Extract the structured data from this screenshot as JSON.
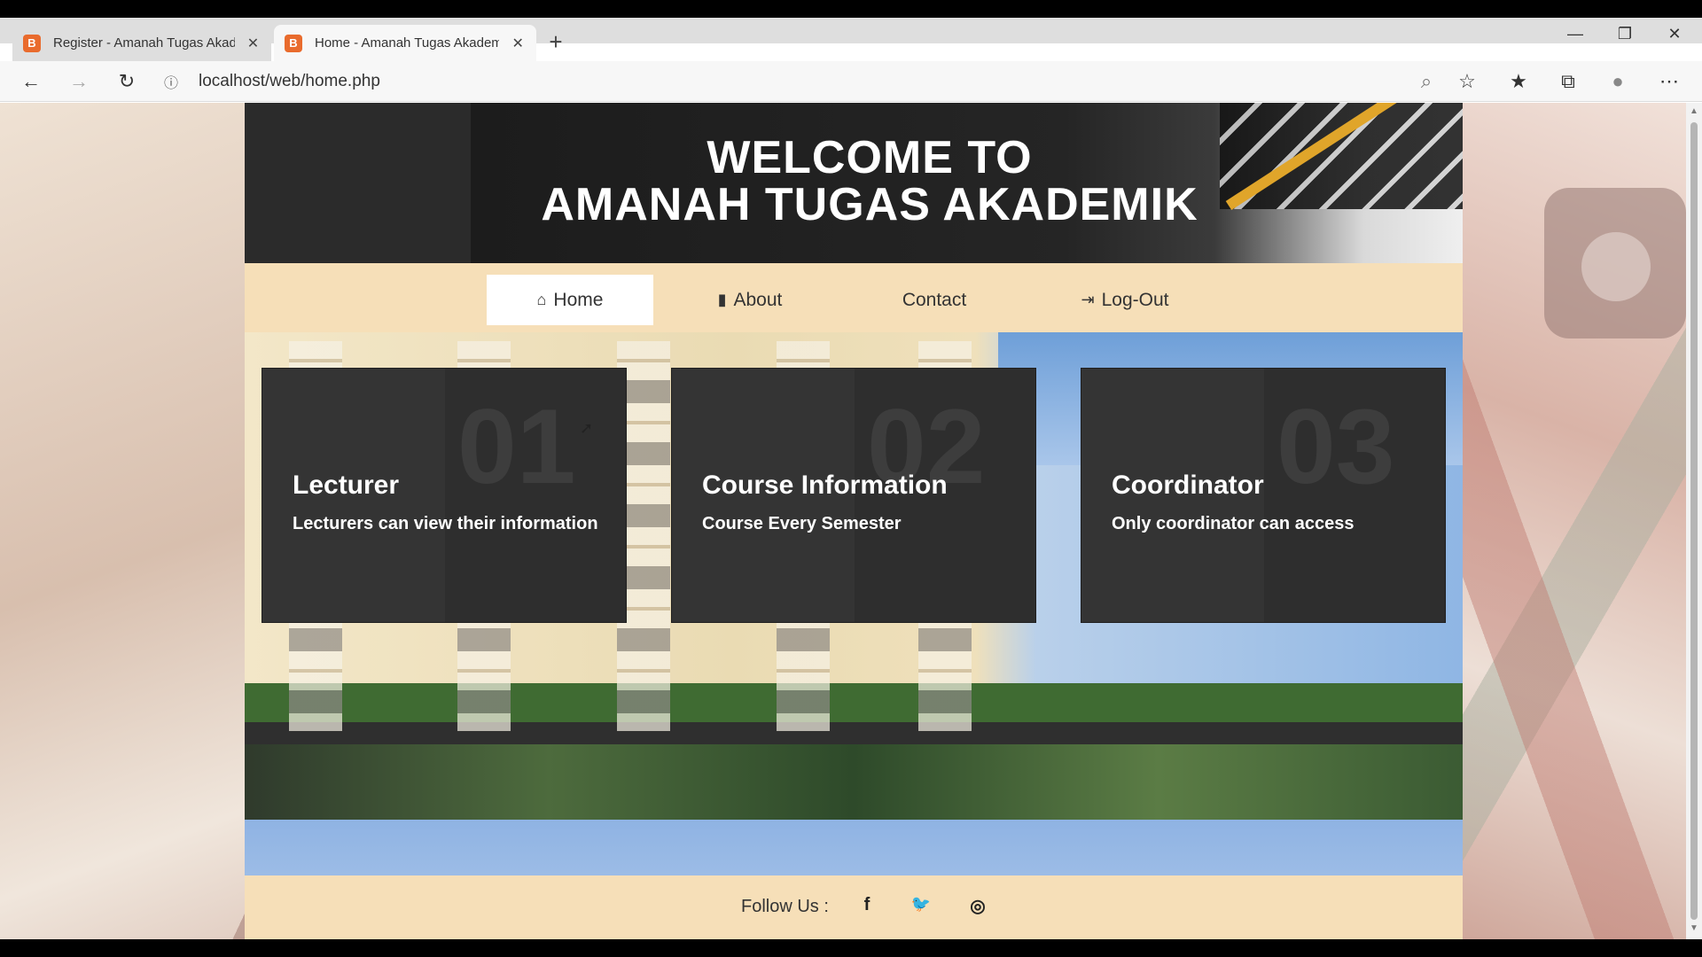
{
  "browser": {
    "tabs": [
      {
        "title": "Register - Amanah Tugas Akade",
        "favicon": "B"
      },
      {
        "title": "Home - Amanah Tugas Akademi",
        "favicon": "B"
      }
    ],
    "new_tab": "+",
    "url": "localhost/web/home.php",
    "window_controls": {
      "minimize": "—",
      "maximize": "❐",
      "close": "✕"
    },
    "icons": {
      "back": "←",
      "forward": "→",
      "reload": "↻",
      "info": "ⓘ",
      "zoom": "⌕",
      "star": "☆",
      "favorites": "★",
      "collections": "⧉",
      "profile": "●",
      "more": "⋯",
      "close_tab": "✕",
      "scroll_up": "▲",
      "scroll_down": "▼"
    }
  },
  "page": {
    "banner": {
      "line1": "WELCOME TO",
      "line2": "AMANAH TUGAS AKADEMIK"
    },
    "nav": [
      {
        "label": "Home",
        "icon": "⌂",
        "active": true
      },
      {
        "label": "About",
        "icon": "▮",
        "active": false
      },
      {
        "label": "Contact",
        "icon": "",
        "active": false
      },
      {
        "label": "Log-Out",
        "icon": "⇥",
        "active": false
      }
    ],
    "cards": [
      {
        "number": "01",
        "title": "Lecturer",
        "desc": "Lecturers can view their information"
      },
      {
        "number": "02",
        "title": "Course Information",
        "desc": "Course Every Semester"
      },
      {
        "number": "03",
        "title": "Coordinator",
        "desc": "Only coordinator can access"
      }
    ],
    "footer": {
      "follow_label": "Follow Us :",
      "social": [
        {
          "name": "facebook-icon",
          "glyph": "f"
        },
        {
          "name": "twitter-icon",
          "glyph": "🐦"
        },
        {
          "name": "instagram-icon",
          "glyph": "◎"
        }
      ]
    }
  },
  "colors": {
    "nav_background": "#f6dfb8",
    "card_background": "#2e2e2e",
    "tab_favicon": "#e96b2d"
  }
}
